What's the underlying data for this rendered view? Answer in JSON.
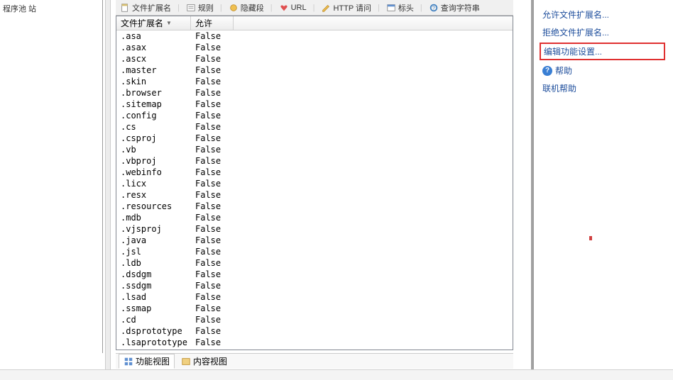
{
  "left_strip": {
    "text": "程序池\n站"
  },
  "toolbar": {
    "items": [
      {
        "label": "文件扩展名"
      },
      {
        "label": "规则"
      },
      {
        "label": "隐藏段"
      },
      {
        "label": "URL"
      },
      {
        "label": "HTTP 请问"
      },
      {
        "label": "标头"
      },
      {
        "label": "查询字符串"
      }
    ]
  },
  "list": {
    "headers": {
      "col1": "文件扩展名",
      "col2": "允许"
    },
    "rows": [
      {
        "ext": ".asa",
        "allow": "False"
      },
      {
        "ext": ".asax",
        "allow": "False"
      },
      {
        "ext": ".ascx",
        "allow": "False"
      },
      {
        "ext": ".master",
        "allow": "False"
      },
      {
        "ext": ".skin",
        "allow": "False"
      },
      {
        "ext": ".browser",
        "allow": "False"
      },
      {
        "ext": ".sitemap",
        "allow": "False"
      },
      {
        "ext": ".config",
        "allow": "False"
      },
      {
        "ext": ".cs",
        "allow": "False"
      },
      {
        "ext": ".csproj",
        "allow": "False"
      },
      {
        "ext": ".vb",
        "allow": "False"
      },
      {
        "ext": ".vbproj",
        "allow": "False"
      },
      {
        "ext": ".webinfo",
        "allow": "False"
      },
      {
        "ext": ".licx",
        "allow": "False"
      },
      {
        "ext": ".resx",
        "allow": "False"
      },
      {
        "ext": ".resources",
        "allow": "False"
      },
      {
        "ext": ".mdb",
        "allow": "False"
      },
      {
        "ext": ".vjsproj",
        "allow": "False"
      },
      {
        "ext": ".java",
        "allow": "False"
      },
      {
        "ext": ".jsl",
        "allow": "False"
      },
      {
        "ext": ".ldb",
        "allow": "False"
      },
      {
        "ext": ".dsdgm",
        "allow": "False"
      },
      {
        "ext": ".ssdgm",
        "allow": "False"
      },
      {
        "ext": ".lsad",
        "allow": "False"
      },
      {
        "ext": ".ssmap",
        "allow": "False"
      },
      {
        "ext": ".cd",
        "allow": "False"
      },
      {
        "ext": ".dsprototype",
        "allow": "False"
      },
      {
        "ext": ".lsaprototype",
        "allow": "False"
      }
    ]
  },
  "tabs": {
    "features": "功能视图",
    "content": "内容视图"
  },
  "actions": {
    "allow": "允许文件扩展名...",
    "deny": "拒绝文件扩展名...",
    "edit": "编辑功能设置...",
    "help": "帮助",
    "online_help": "联机帮助"
  }
}
